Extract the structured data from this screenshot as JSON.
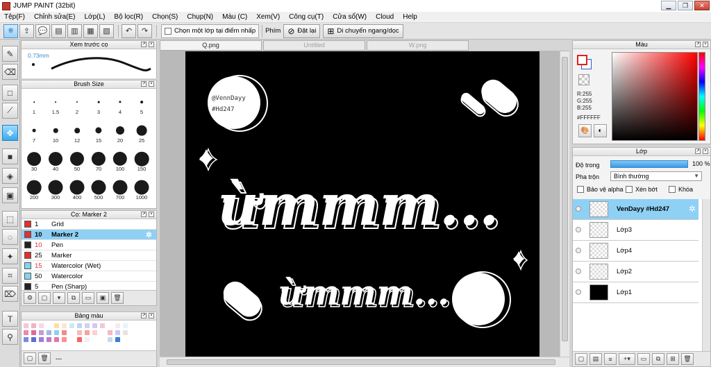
{
  "window": {
    "title": "JUMP PAINT (32bit)",
    "min_label": "▁",
    "max_label": "❐",
    "close_label": "✕"
  },
  "menu": [
    "Tệp(F)",
    "Chỉnh sửa(E)",
    "Lớp(L)",
    "Bộ lọc(R)",
    "Chọn(S)",
    "Chụp(N)",
    "Màu (C)",
    "Xem(V)",
    "Công cụ(T)",
    "Cửa sổ(W)",
    "Cloud",
    "Help"
  ],
  "toolbar": {
    "snap_checkbox_label": "Chọn một lớp tại điểm nhấp",
    "shortcut_label": "Phím",
    "reset_label": "Đặt lại",
    "flip_label": "Di chuyển ngang/dọc"
  },
  "brush_preview": {
    "title": "Xem trước cọ",
    "size": "0.73mm"
  },
  "brush_size": {
    "title": "Brush Size",
    "sizes": [
      "1",
      "1.5",
      "2",
      "3",
      "4",
      "5",
      "7",
      "10",
      "12",
      "15",
      "20",
      "25",
      "30",
      "40",
      "50",
      "70",
      "100",
      "150",
      "200",
      "300",
      "400",
      "500",
      "700",
      "1000"
    ]
  },
  "brush_list": {
    "title": "Cọ: Marker 2",
    "items": [
      {
        "num": "1",
        "name": "Grid",
        "color": "#e03030",
        "red": false,
        "selected": false
      },
      {
        "num": "10",
        "name": "Marker 2",
        "color": "#e03030",
        "red": false,
        "selected": true
      },
      {
        "num": "10",
        "name": "Pen",
        "color": "#222222",
        "red": true,
        "selected": false
      },
      {
        "num": "25",
        "name": "Marker",
        "color": "#e03030",
        "red": false,
        "selected": false
      },
      {
        "num": "15",
        "name": "Watercolor (Wet)",
        "color": "#7fd6f0",
        "red": true,
        "selected": false
      },
      {
        "num": "50",
        "name": "Watercolor",
        "color": "#7fd6f0",
        "red": false,
        "selected": false
      },
      {
        "num": "5",
        "name": "Pen (Sharp)",
        "color": "#222222",
        "red": false,
        "selected": false
      }
    ]
  },
  "palette": {
    "title": "Bảng màu",
    "footer_text": "---"
  },
  "tabs": [
    {
      "label": "Q.png",
      "active": true
    },
    {
      "label": "Untitled",
      "active": false
    },
    {
      "label": "W.png",
      "active": false
    }
  ],
  "canvas": {
    "username": "@VennDayy",
    "hashtag": "#Hd247",
    "big_text": "ừmmm...",
    "small_text": "ừmmm..."
  },
  "color_panel": {
    "title": "Màu",
    "r": "R:255",
    "g": "G:255",
    "b": "B:255",
    "hex": "#FFFFFF"
  },
  "layer_panel": {
    "title": "Lớp",
    "opacity_label": "Độ trong",
    "opacity_value": "100 %",
    "opacity_fraction": 1.0,
    "blend_label": "Pha trộn",
    "blend_value": "Bình thường",
    "protect_alpha": "Bảo vệ alpha",
    "clipping": "Xén bớt",
    "lock": "Khóa",
    "layers": [
      {
        "name": "VenDayy #Hd247",
        "selected": true,
        "black": false
      },
      {
        "name": "Lớp3",
        "selected": false,
        "black": false
      },
      {
        "name": "Lớp4",
        "selected": false,
        "black": false
      },
      {
        "name": "Lớp2",
        "selected": false,
        "black": false
      },
      {
        "name": "Lớp1",
        "selected": false,
        "black": true
      }
    ]
  }
}
